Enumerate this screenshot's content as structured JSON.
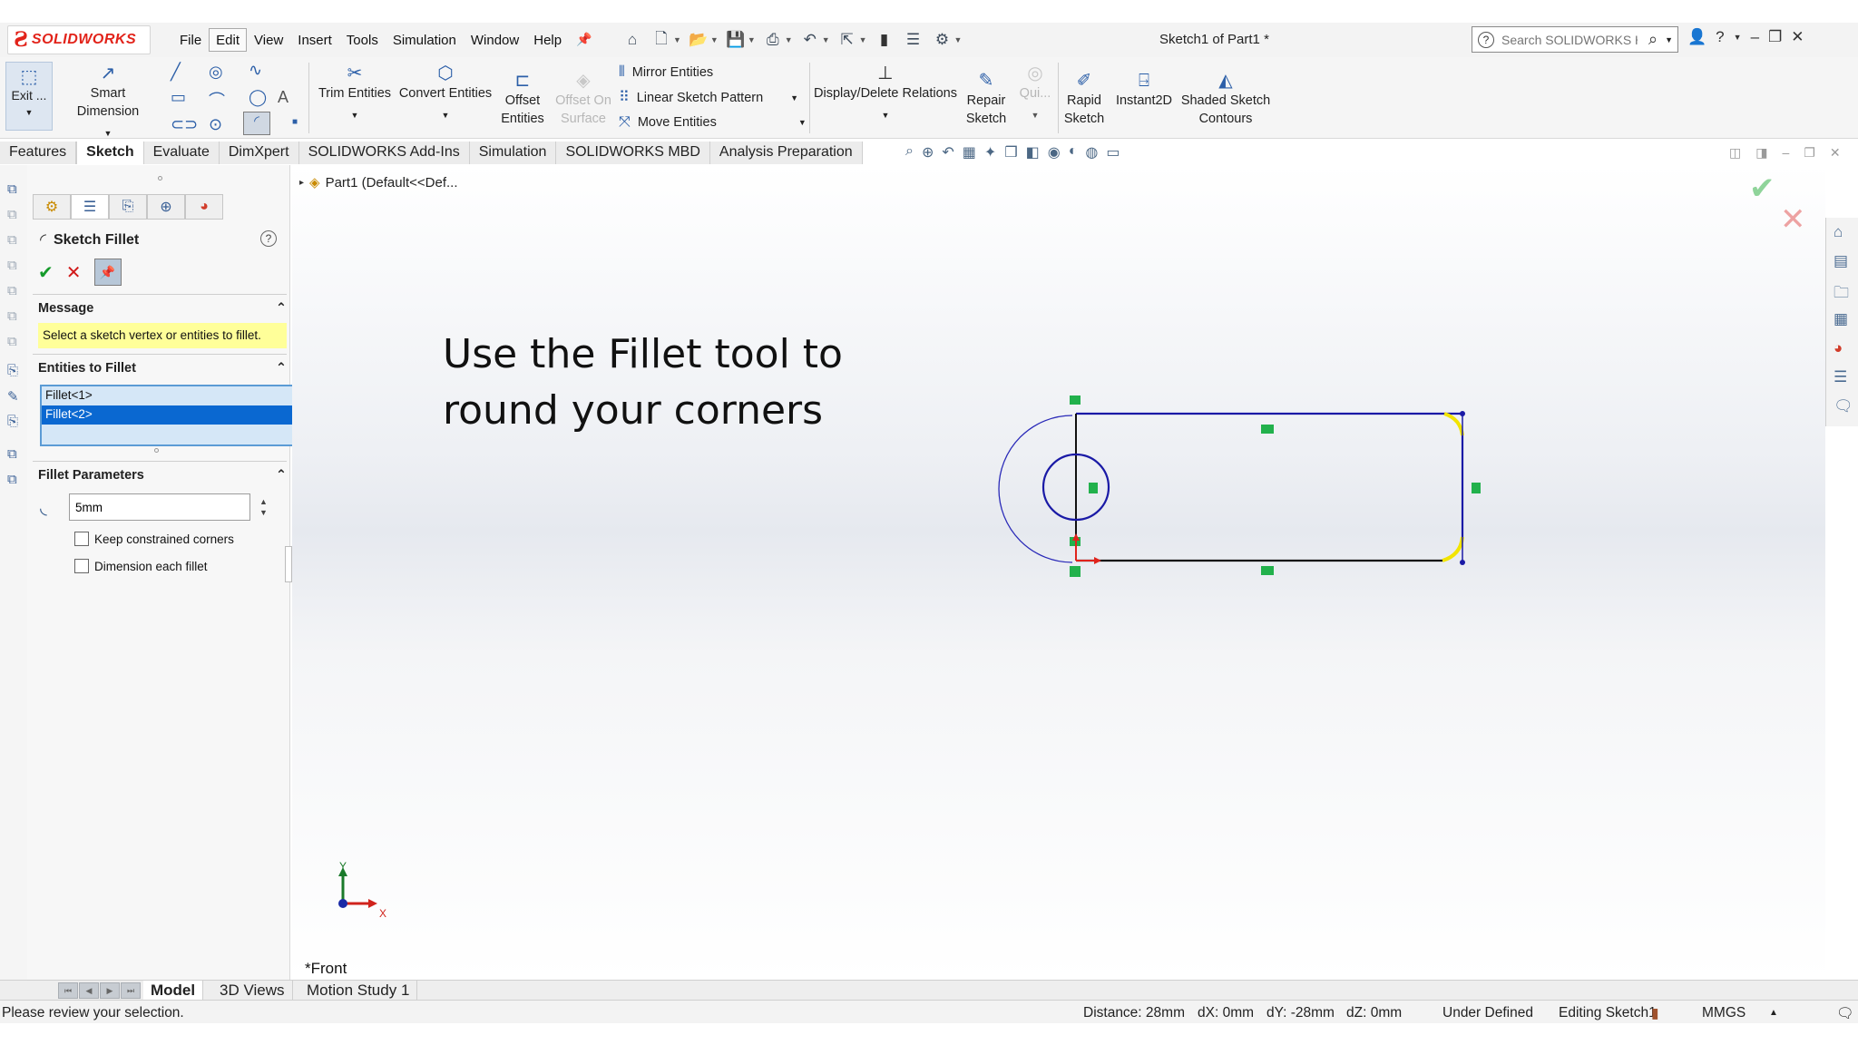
{
  "app": {
    "brand": "SOLIDWORKS",
    "document_title": "Sketch1 of Part1 *"
  },
  "menu": [
    "File",
    "Edit",
    "View",
    "Insert",
    "Tools",
    "Simulation",
    "Window",
    "Help"
  ],
  "menu_active": "Edit",
  "help_search": {
    "placeholder": "Search SOLIDWORKS Help"
  },
  "command_manager": {
    "exit": "Exit ...",
    "smart_dimension": "Smart Dimension",
    "trim_entities": "Trim Entities",
    "convert_entities": "Convert Entities",
    "offset_entities": [
      "Offset",
      "Entities"
    ],
    "offset_on_surface": [
      "Offset On",
      "Surface"
    ],
    "mirror_entities": "Mirror Entities",
    "linear_sketch_pattern": "Linear Sketch Pattern",
    "move_entities": "Move Entities",
    "display_delete_relations": "Display/Delete Relations",
    "repair_sketch": [
      "Repair",
      "Sketch"
    ],
    "quick_snaps": "Qui...",
    "rapid_sketch": [
      "Rapid",
      "Sketch"
    ],
    "instant2d": "Instant2D",
    "shaded_sketch_contours": [
      "Shaded Sketch",
      "Contours"
    ]
  },
  "tabs": [
    "Features",
    "Sketch",
    "Evaluate",
    "DimXpert",
    "SOLIDWORKS Add-Ins",
    "Simulation",
    "SOLIDWORKS MBD",
    "Analysis Preparation"
  ],
  "tab_active": "Sketch",
  "tree": {
    "node": "Part1  (Default<<Def..."
  },
  "property_manager": {
    "title": "Sketch Fillet",
    "message_header": "Message",
    "message": "Select a sketch vertex or entities to fillet.",
    "entities_header": "Entities to Fillet",
    "entities": [
      {
        "label": "Fillet<1>",
        "selected": false
      },
      {
        "label": "Fillet<2>",
        "selected": true
      }
    ],
    "params_header": "Fillet Parameters",
    "radius": "5mm",
    "keep_constrained": "Keep constrained corners",
    "dimension_each": "Dimension each fillet"
  },
  "viewport": {
    "overlay_line1": "Use the Fillet tool to",
    "overlay_line2": "round your corners",
    "view_label": "*Front",
    "triad_x": "X",
    "triad_y": "Y"
  },
  "bottom_tabs": [
    "Model",
    "3D Views",
    "Motion Study 1"
  ],
  "bottom_tab_active": "Model",
  "status": {
    "message": "Please review your selection.",
    "distance": "Distance: 28mm",
    "dx": "dX: 0mm",
    "dy": "dY: -28mm",
    "dz": "dZ: 0mm",
    "state": "Under Defined",
    "editing": "Editing Sketch1",
    "units": "MMGS"
  },
  "colors": {
    "sketch_blue": "#1a1aa6",
    "fillet_highlight": "#f2e400",
    "relation_green": "#22b14c",
    "origin_red": "#e0231c",
    "selection_blue": "#0a68d1",
    "message_yellow": "#ffff99"
  }
}
